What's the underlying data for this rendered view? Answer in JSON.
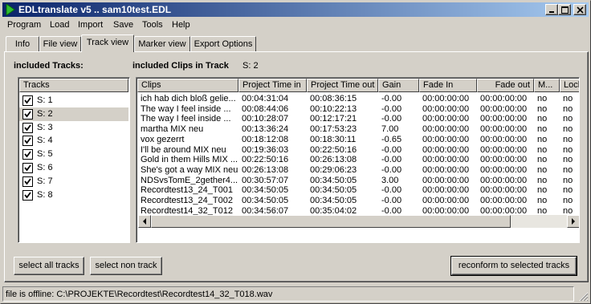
{
  "window": {
    "title": "EDLtranslate v5 .. sam10test.EDL",
    "controls": [
      "minimize",
      "maximize",
      "close"
    ]
  },
  "menu": [
    "Program",
    "Load",
    "Import",
    "Save",
    "Tools",
    "Help"
  ],
  "tabs": [
    {
      "label": "Info",
      "active": false
    },
    {
      "label": "File view",
      "active": false
    },
    {
      "label": "Track view",
      "active": true
    },
    {
      "label": "Marker view",
      "active": false
    },
    {
      "label": "Export Options",
      "active": false
    }
  ],
  "tracks_panel": {
    "heading": "included Tracks:",
    "column_header": "Tracks",
    "selected_index": 1,
    "items": [
      {
        "label": "S:  1",
        "checked": true
      },
      {
        "label": "S:  2",
        "checked": true
      },
      {
        "label": "S:  3",
        "checked": true
      },
      {
        "label": "S:  4",
        "checked": true
      },
      {
        "label": "S:  5",
        "checked": true
      },
      {
        "label": "S:  6",
        "checked": true
      },
      {
        "label": "S:  7",
        "checked": true
      },
      {
        "label": "S:  8",
        "checked": true
      }
    ]
  },
  "clips_panel": {
    "heading": "included Clips in Track",
    "track_id": "S:  2",
    "columns": [
      "Clips",
      "Project Time in",
      "Project Time out",
      "Gain",
      "Fade In",
      "Fade out",
      "M...",
      "Locke"
    ],
    "rows": [
      [
        "ich hab dich bloß gelie...",
        "00:04:31:04",
        "00:08:36:15",
        "-0.00",
        "00:00:00:00",
        "00:00:00:00",
        "no",
        "no"
      ],
      [
        "The way I feel inside ...",
        "00:08:44:06",
        "00:10:22:13",
        "-0.00",
        "00:00:00:00",
        "00:00:00:00",
        "no",
        "no"
      ],
      [
        "The way I feel inside ...",
        "00:10:28:07",
        "00:12:17:21",
        "-0.00",
        "00:00:00:00",
        "00:00:00:00",
        "no",
        "no"
      ],
      [
        "martha MIX neu",
        "00:13:36:24",
        "00:17:53:23",
        "7.00",
        "00:00:00:00",
        "00:00:00:00",
        "no",
        "no"
      ],
      [
        "vox gezerrt",
        "00:18:12:08",
        "00:18:30:11",
        "-0.65",
        "00:00:00:00",
        "00:00:00:00",
        "no",
        "no"
      ],
      [
        "I'll be around MIX neu",
        "00:19:36:03",
        "00:22:50:16",
        "-0.00",
        "00:00:00:00",
        "00:00:00:00",
        "no",
        "no"
      ],
      [
        "Gold in them Hills MIX ...",
        "00:22:50:16",
        "00:26:13:08",
        "-0.00",
        "00:00:00:00",
        "00:00:00:00",
        "no",
        "no"
      ],
      [
        "She's got a way MIX neu",
        "00:26:13:08",
        "00:29:06:23",
        "-0.00",
        "00:00:00:00",
        "00:00:00:00",
        "no",
        "no"
      ],
      [
        "NDSvsTomE_2gether4...",
        "00:30:57:07",
        "00:34:50:05",
        "3.00",
        "00:00:00:00",
        "00:00:00:00",
        "no",
        "no"
      ],
      [
        "Recordtest13_24_T001",
        "00:34:50:05",
        "00:34:50:05",
        "-0.00",
        "00:00:00:00",
        "00:00:00:00",
        "no",
        "no"
      ],
      [
        "Recordtest13_24_T002",
        "00:34:50:05",
        "00:34:50:05",
        "-0.00",
        "00:00:00:00",
        "00:00:00:00",
        "no",
        "no"
      ],
      [
        "Recordtest14_32_T012",
        "00:34:56:07",
        "00:35:04:02",
        "-0.00",
        "00:00:00:00",
        "00:00:00:00",
        "no",
        "no"
      ]
    ]
  },
  "buttons": {
    "select_all": "select all tracks",
    "select_non": "select non track",
    "reconform": "reconform to selected tracks"
  },
  "status": "file is offline: C:\\PROJEKTE\\Recordtest\\Recordtest14_32_T018.wav",
  "colors": {
    "title_start": "#0a246a",
    "title_end": "#a6caf0",
    "face": "#d4d0c8",
    "list_bg": "#ffffff"
  },
  "icons": [
    "play-icon",
    "minimize-icon",
    "maximize-icon",
    "close-icon",
    "checkmark-icon",
    "arrow-left-icon",
    "arrow-right-icon",
    "size-grip-icon"
  ]
}
